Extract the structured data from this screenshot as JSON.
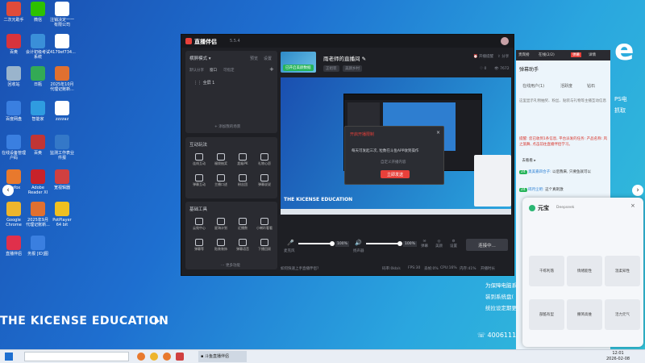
{
  "desktop": {
    "icons": [
      {
        "label": "二次元助手",
        "color": "#e04b3a"
      },
      {
        "label": "微信",
        "color": "#2dc100"
      },
      {
        "label": "注销决定一一有限公司",
        "color": "#ffffff"
      },
      {
        "label": "百奥",
        "color": "#d8343c"
      },
      {
        "label": "会计初级考试系统",
        "color": "#3a8fd8"
      },
      {
        "label": "4179ef734...",
        "color": "#ffffff"
      },
      {
        "label": "回收站",
        "color": "#9ab4cc"
      },
      {
        "label": "日瓶",
        "color": "#33aa55"
      },
      {
        "label": "2025年10月代理记账新...",
        "color": "#e07030"
      },
      {
        "label": "百度网盘",
        "color": "#3a7fe0"
      },
      {
        "label": "智能家",
        "color": "#2f9ce0"
      },
      {
        "label": "zzzzaz",
        "color": "#ffffff"
      },
      {
        "label": "在线设备管理户码",
        "color": "#3a7fe0"
      },
      {
        "label": "百奥",
        "color": "#c03535"
      },
      {
        "label": "监测工作表业件报",
        "color": "#3478c8"
      },
      {
        "label": "Firefox",
        "color": "#e8792d"
      },
      {
        "label": "Adobe Reader XI",
        "color": "#c8222a"
      },
      {
        "label": "宽视辑器",
        "color": "#d04040"
      },
      {
        "label": "Google Chrome",
        "color": "#eeb52c"
      },
      {
        "label": "2025年9月代理记账新...",
        "color": "#e07030"
      },
      {
        "label": "PotPlayer 64 bit",
        "color": "#f0c020"
      },
      {
        "label": "直播伴侣",
        "color": "#e0304b"
      },
      {
        "label": "务报 [ID]图",
        "color": "#3a7fe0"
      }
    ]
  },
  "app": {
    "title": "直播伴侣",
    "version": "5.5.4",
    "mode_label": "横屏模式",
    "top_links": [
      "预览",
      "设置"
    ],
    "scene_tabs": [
      "默认分享",
      "窗口",
      "可指定"
    ],
    "scene_item": "全屏 1",
    "add_scene_hint": "+ 添加我的场景",
    "interaction_title": "互动玩法",
    "interaction_tools": [
      "连线互动",
      "福袋抽奖",
      "超级PK",
      "礼物心愿",
      "弹幕互动",
      "主播口述",
      "粉丝团",
      "弹幕说说"
    ],
    "basic_title": "基础工具",
    "basic_tools": [
      "云效中心",
      "星海计划",
      "近播数",
      "小喇叭看看",
      "弹幕等",
      "贴装装饰",
      "弹幕语音",
      "下播回顾"
    ],
    "more_label": "更多功能",
    "stream_title": "雨老师的直播间",
    "badge_label": "已开启美颜数据",
    "sub_tags": [
      "正组装",
      "美颜乡村"
    ],
    "header_right": [
      "开播提醒",
      "分享"
    ],
    "header_counts": [
      "0",
      "7672"
    ],
    "preview_caption": "THE KICENSE EDUCATION",
    "mic_label": "麦克风",
    "mic_percent": "100%",
    "speaker_label": "扬声器",
    "speaker_percent": "100%",
    "bottom_icons": [
      "弹幕",
      "美颜",
      "设置"
    ],
    "connect_button": "连接中...",
    "status_bar": [
      "如何快速上手直播伴侣?",
      "码率:0kb/s",
      "FPS:30",
      "丢帧:0%",
      "CPU:16%",
      "内存:41%",
      "开播时长"
    ],
    "dialog": {
      "title": "开启开播限制",
      "line1": "每天可发起三次, 粒数在斗鱼APP收到操作",
      "line2": "自定义开播内容",
      "button": "立即发送"
    }
  },
  "side": {
    "tabs": [
      "贵宾榜",
      "在线(2/2)",
      "弹幕",
      "详情"
    ],
    "assistant_title": "弹幕助手",
    "online_label": "在线用户(1)",
    "activity_label": "活跃度",
    "gift_label": "钻石",
    "intro": "这里显示礼物抽奖、粉丝、贴装与礼物等主播互动信息",
    "notice": "提醒: 您已收到1条信息, 平台派发的任务: 产品名称: 风之旅舞, 点击前往直播伴侣学习。",
    "go_see": "去看看",
    "level_pill_1": "24",
    "user1": "奥美嘉四合子:",
    "msg1": "以后我来, 只要鱼就可以",
    "level_pill_2": "24",
    "user2": "碎月尘吧:",
    "msg2": "这个真刺激",
    "bg_text": [
      "为保障电脑系",
      "装到系统盘(",
      "统拉设定期更"
    ],
    "phone": "4006111"
  },
  "yuanbao": {
    "title": "元宝",
    "model": "Deepseek",
    "cards": [
      "千练利落",
      "情绪能性",
      "温柔知性",
      "部酷有型",
      "撒简高维",
      "活力元气"
    ]
  },
  "background": {
    "brand_text": "THE KICENSE EDUCATION",
    "right_letter": "e",
    "ps_text": "PS电",
    "ps_text2": "抓取"
  },
  "taskbar": {
    "app_label": "斗鱼直播伴侣",
    "time": "12:01",
    "date": "2026-02-08"
  },
  "colors": {
    "accent_red": "#e8403a",
    "badge_green": "#26b45a",
    "connect_bg": "#3a3c44"
  }
}
